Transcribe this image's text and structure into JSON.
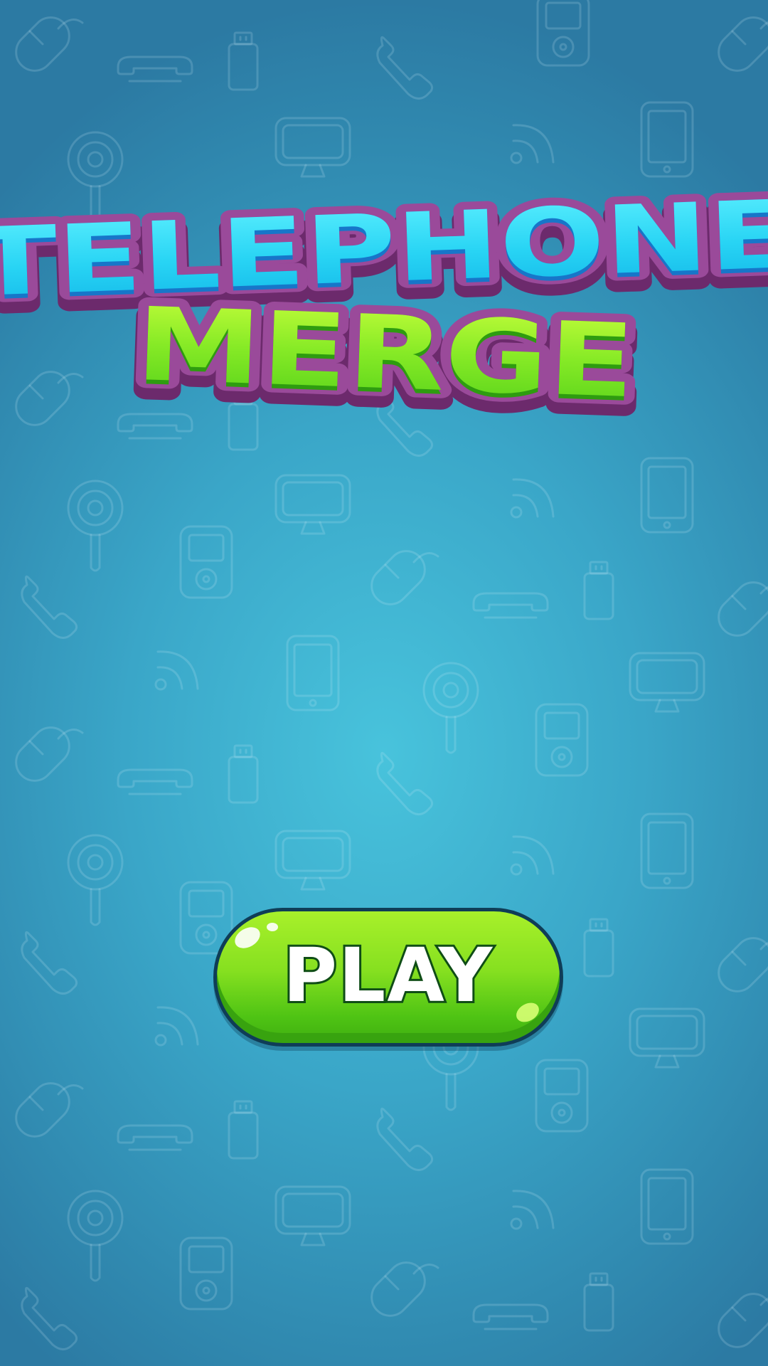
{
  "game": {
    "title_line1": "TELEPHONE",
    "title_line2": "MERGE",
    "play_label": "PLAY"
  },
  "background": {
    "pattern_icons": [
      "computer-mouse-icon",
      "landline-handset-icon",
      "usb-drive-icon",
      "phone-receiver-icon",
      "monitor-icon",
      "ipod-icon",
      "wifi-signal-icon",
      "tablet-icon",
      "ring-microphone-icon"
    ]
  },
  "colors": {
    "background_center": "#48c3dc",
    "background_edge": "#2c7aa3",
    "title_line1_fill": "#28d4f4",
    "title_line2_fill": "#7ee62c",
    "title_outline": "#8a3d8a",
    "play_button": "#86e020",
    "play_button_border": "#0f3d57"
  }
}
